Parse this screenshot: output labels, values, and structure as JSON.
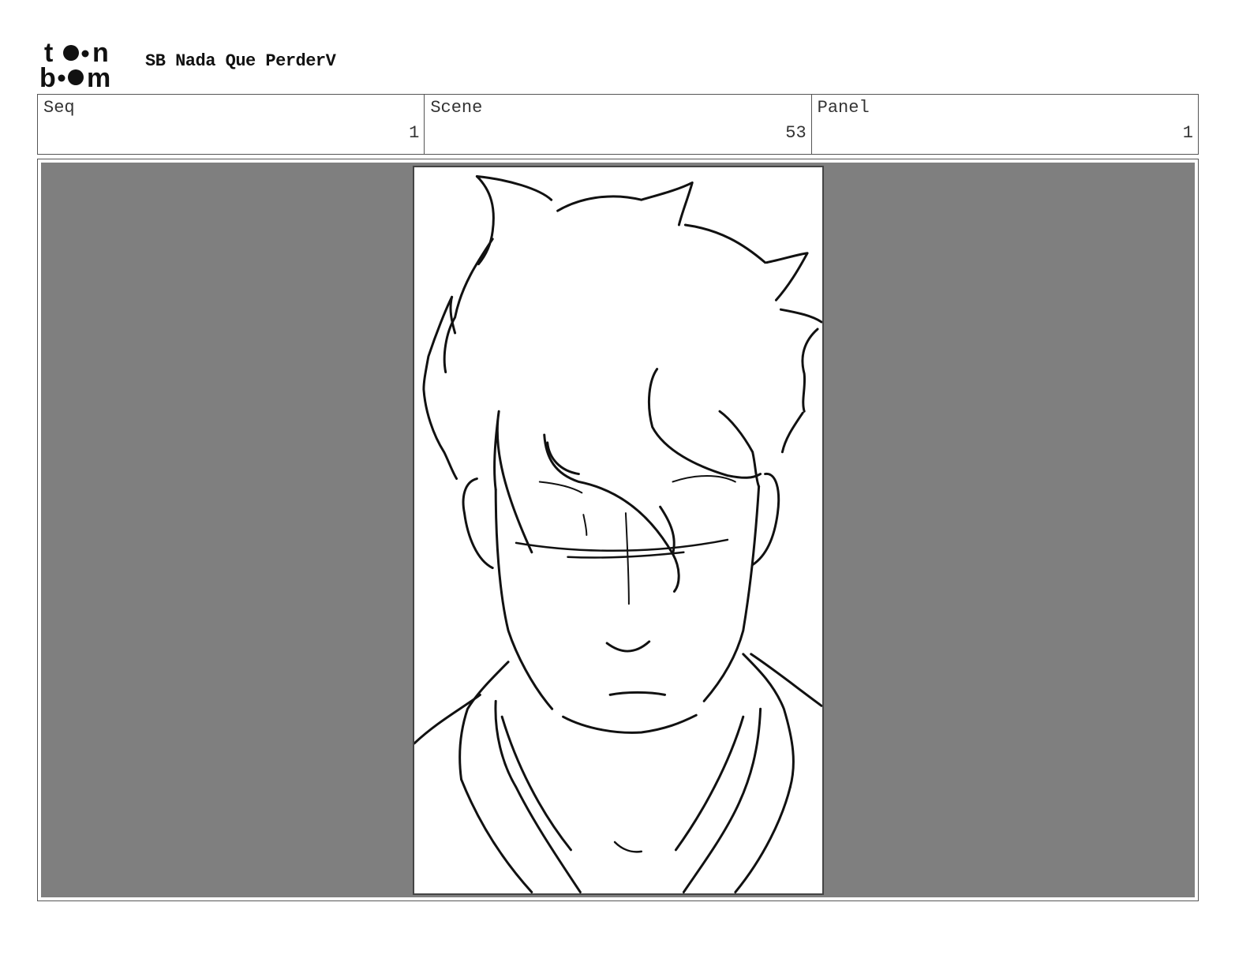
{
  "header": {
    "logo_text_top": "t",
    "logo_text_top_end": "n",
    "logo_text_bottom": "b",
    "logo_text_bottom_end": "m",
    "project_title": "SB Nada Que PerderV"
  },
  "info": {
    "seq_label": "Seq",
    "seq_value": "1",
    "scene_label": "Scene",
    "scene_value": "53",
    "panel_label": "Panel",
    "panel_value": "1"
  },
  "colors": {
    "panel_background": "#7f7f7f",
    "sketch_background": "#ffffff",
    "line": "#111111"
  },
  "icons": {
    "logo": "toonboom-logo-icon"
  }
}
